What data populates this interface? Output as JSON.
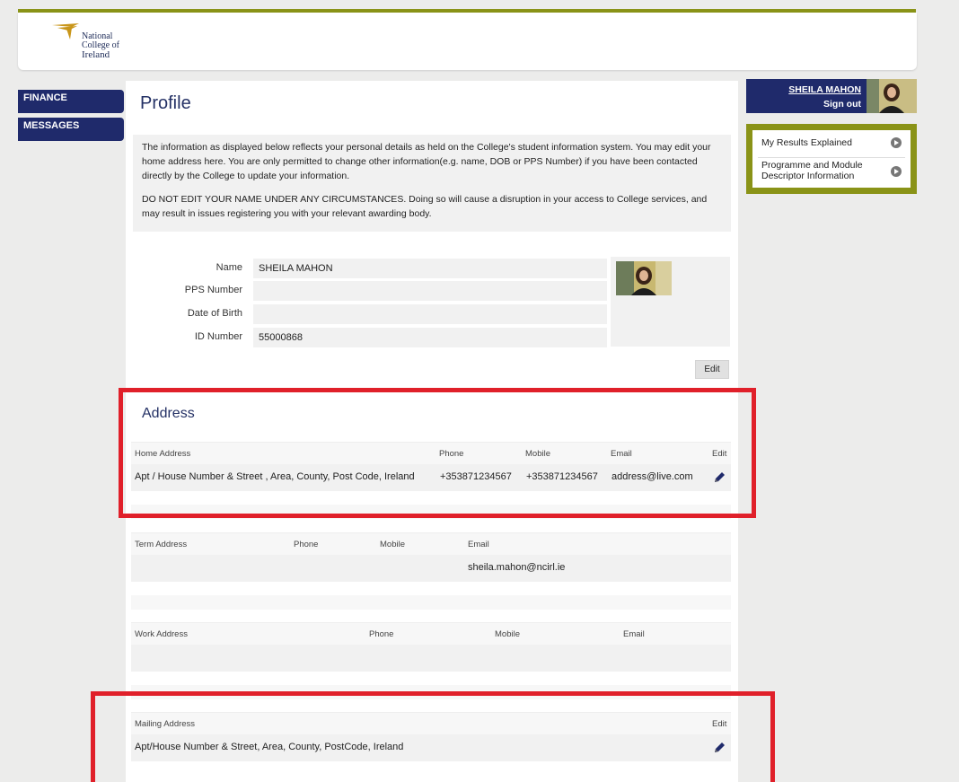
{
  "header": {
    "logo_lines": [
      "National",
      "College of",
      "Ireland"
    ]
  },
  "nav": {
    "finance": "FINANCE",
    "messages": "MESSAGES"
  },
  "user": {
    "name": "SHEILA MAHON",
    "sign_out": "Sign out"
  },
  "quick_links": [
    {
      "label": "My Results Explained"
    },
    {
      "label": "Programme and Module Descriptor Information"
    }
  ],
  "profile": {
    "title": "Profile",
    "info_paragraph_1": "The information as displayed below reflects your personal details as held on the College's student information system. You may edit your home address here. You are only permitted to change other information(e.g. name, DOB or PPS Number) if you have been contacted directly by the College to update your information.",
    "info_paragraph_2": "DO NOT EDIT YOUR NAME UNDER ANY CIRCUMSTANCES. Doing so will cause a disruption in your access to College services, and may result in issues registering you with your relevant awarding body.",
    "fields": [
      {
        "label": "Name",
        "value": "SHEILA MAHON"
      },
      {
        "label": "PPS Number",
        "value": ""
      },
      {
        "label": "Date of Birth",
        "value": ""
      },
      {
        "label": "ID Number",
        "value": "55000868"
      }
    ],
    "edit_button": "Edit"
  },
  "address": {
    "title": "Address",
    "home": {
      "headers": {
        "address": "Home Address",
        "phone": "Phone",
        "mobile": "Mobile",
        "email": "Email",
        "edit": "Edit"
      },
      "row": {
        "address": "Apt / House Number & Street , Area, County, Post Code, Ireland",
        "phone": "+353871234567",
        "mobile": "+353871234567",
        "email": "address@live.com"
      }
    },
    "term": {
      "headers": {
        "address": "Term Address",
        "phone": "Phone",
        "mobile": "Mobile",
        "email": "Email"
      },
      "row": {
        "address": "",
        "phone": "",
        "mobile": "",
        "email": "sheila.mahon@ncirl.ie"
      }
    },
    "work": {
      "headers": {
        "address": "Work Address",
        "phone": "Phone",
        "mobile": "Mobile",
        "email": "Email"
      },
      "row": {
        "address": "",
        "phone": "",
        "mobile": "",
        "email": ""
      }
    },
    "mailing": {
      "headers": {
        "address": "Mailing Address",
        "edit": "Edit"
      },
      "row": {
        "address": "Apt/House Number & Street, Area, County, PostCode, Ireland"
      }
    }
  },
  "colors": {
    "navy": "#1f2a6b",
    "olive": "#8a9317",
    "highlight_red": "#e0202a",
    "title_blue": "#243165"
  }
}
